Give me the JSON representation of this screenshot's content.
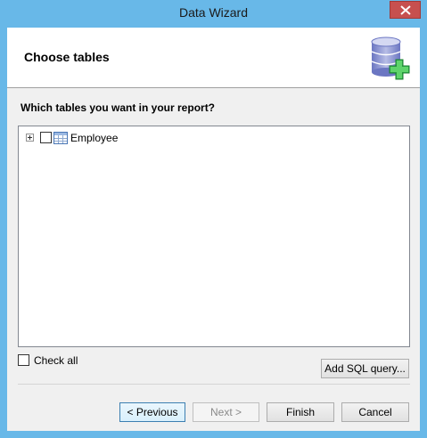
{
  "window": {
    "title": "Data Wizard",
    "close_icon": "close-icon"
  },
  "header": {
    "title": "Choose tables",
    "icon": "database-add-icon"
  },
  "main": {
    "question": "Which tables you want in your report?",
    "tree": {
      "items": [
        {
          "label": "Employee",
          "checked": false,
          "expanded": false,
          "icon": "table-icon"
        }
      ]
    },
    "check_all_label": "Check all",
    "check_all_checked": false,
    "add_sql_label": "Add SQL query..."
  },
  "footer": {
    "previous_label": "< Previous",
    "next_label": "Next >",
    "finish_label": "Finish",
    "cancel_label": "Cancel"
  },
  "colors": {
    "title_bar": "#68b8e8",
    "close_button": "#c7504f",
    "dialog_background": "#f0f0f0"
  }
}
